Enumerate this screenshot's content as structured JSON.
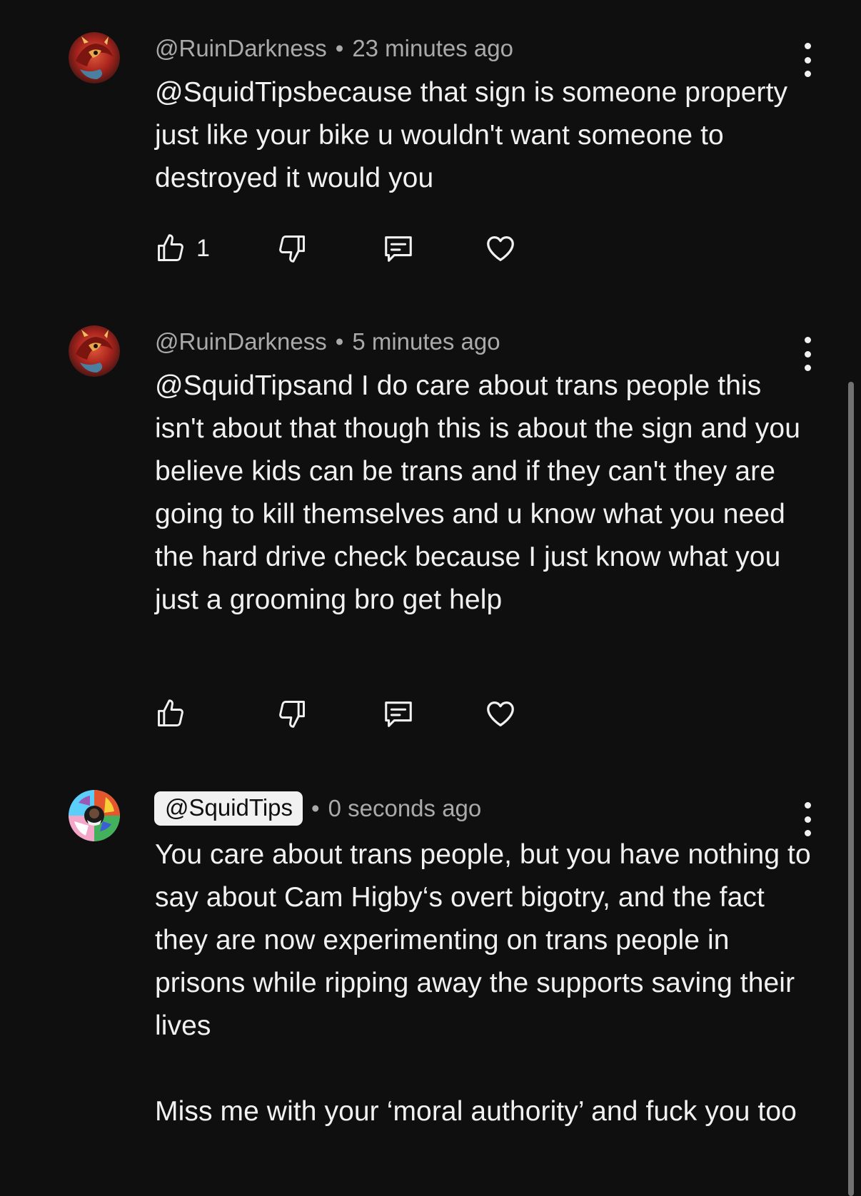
{
  "comments": [
    {
      "handle": "@RuinDarkness",
      "separator": "•",
      "time": "23 minutes ago",
      "text": "@SquidTipsbecause that sign is someone property just like your bike u wouldn't want someone to destroyed it would you",
      "likes": "1",
      "avatar_icon": "dragon-avatar",
      "highlighted": false
    },
    {
      "handle": "@RuinDarkness",
      "separator": "•",
      "time": "5 minutes ago",
      "text": "@SquidTipsand I do care about trans people this isn't about that though this is about the sign and you believe kids can be trans and if they can't they are going to kill themselves and u know what you need the hard drive check because I just know what you just a grooming bro get help",
      "likes": "",
      "avatar_icon": "dragon-avatar",
      "highlighted": false
    },
    {
      "handle": "@SquidTips",
      "separator": "•",
      "time": "0 seconds ago",
      "text": "You care about trans people, but you have nothing to say about Cam Higby‘s overt bigotry, and the fact they are now experimenting on trans people in prisons while ripping away the supports saving their lives\n\nMiss me with your ‘moral authority’ and fuck you too",
      "avatar_icon": "pride-flag-avatar",
      "highlighted": true
    }
  ],
  "icons": {
    "like": "thumbs-up-icon",
    "dislike": "thumbs-down-icon",
    "reply": "reply-icon",
    "heart": "heart-icon",
    "more": "more-vertical-icon"
  },
  "colors": {
    "background": "#0f0f0f",
    "text": "#f1f1f1",
    "meta": "#aaaaaa",
    "scrollbar": "#717171"
  }
}
